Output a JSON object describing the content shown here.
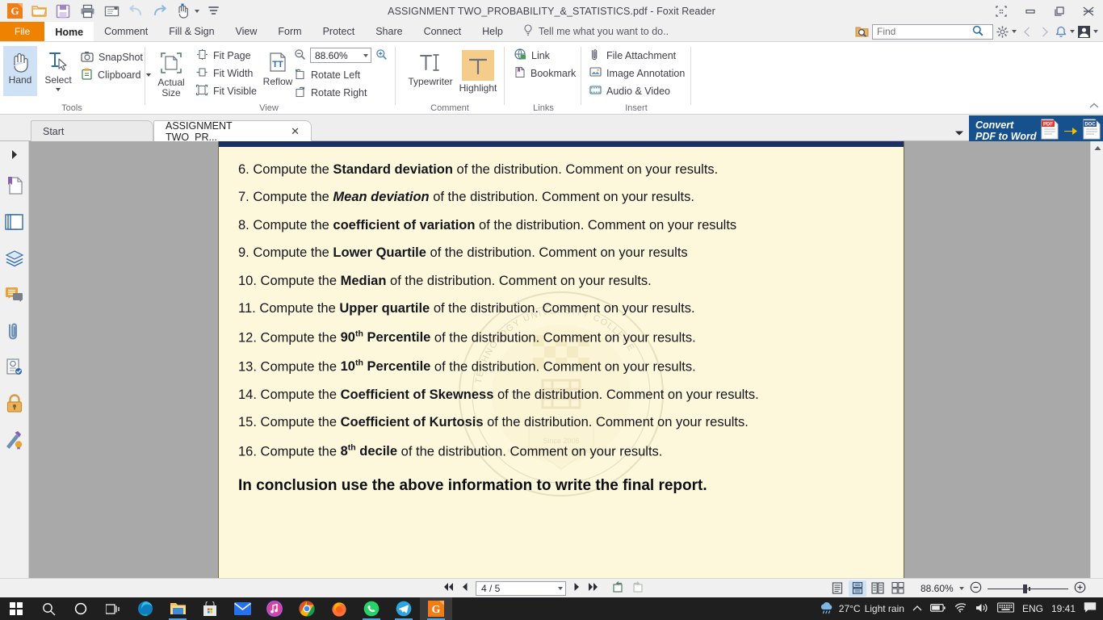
{
  "window": {
    "title": "ASSIGNMENT TWO_PROBABILITY_&_STATISTICS.pdf - Foxit Reader",
    "controls": [
      "restore-all-icon",
      "minimize-icon",
      "maximize-icon",
      "close-icon"
    ]
  },
  "quick_access": [
    {
      "name": "foxit-logo-icon",
      "label": "Foxit"
    },
    {
      "name": "open-folder-icon",
      "label": "Open"
    },
    {
      "name": "save-icon",
      "label": "Save"
    },
    {
      "name": "print-icon",
      "label": "Print"
    },
    {
      "name": "email-icon",
      "label": "Email"
    },
    {
      "name": "undo-icon",
      "label": "Undo"
    },
    {
      "name": "redo-icon",
      "label": "Redo"
    },
    {
      "name": "hand-tool-icon",
      "label": "Hand Tool"
    },
    {
      "name": "customize-toolbar-icon",
      "label": "Customize"
    }
  ],
  "menu": {
    "tabs": [
      {
        "label": "File",
        "kind": "file"
      },
      {
        "label": "Home",
        "kind": "active"
      },
      {
        "label": "Comment",
        "kind": "normal"
      },
      {
        "label": "Fill & Sign",
        "kind": "normal"
      },
      {
        "label": "View",
        "kind": "normal"
      },
      {
        "label": "Form",
        "kind": "normal"
      },
      {
        "label": "Protect",
        "kind": "normal"
      },
      {
        "label": "Share",
        "kind": "normal"
      },
      {
        "label": "Connect",
        "kind": "normal"
      },
      {
        "label": "Help",
        "kind": "normal"
      }
    ],
    "tell_me": "Tell me what you want to do..",
    "find_placeholder": "Find",
    "find_value": ""
  },
  "ribbon": {
    "groups": [
      {
        "label": "Tools",
        "big": [
          {
            "label": "Hand",
            "icon": "hand-icon",
            "selected": true
          },
          {
            "label": "Select",
            "icon": "select-text-icon",
            "selected": false,
            "dropdown": true
          }
        ],
        "small": [
          {
            "label": "SnapShot",
            "icon": "camera-icon",
            "dropdown": false
          },
          {
            "label": "Clipboard",
            "icon": "clipboard-icon",
            "dropdown": true
          }
        ]
      },
      {
        "label": "View",
        "big": [
          {
            "label": "Actual Size",
            "icon": "actual-size-icon",
            "selected": false
          },
          {
            "label": "Reflow",
            "icon": "reflow-icon",
            "selected": false
          }
        ],
        "small": [
          {
            "label": "Fit Page",
            "icon": "fit-page-icon"
          },
          {
            "label": "Fit Width",
            "icon": "fit-width-icon"
          },
          {
            "label": "Fit Visible",
            "icon": "fit-visible-icon"
          },
          {
            "label": "Rotate Left",
            "icon": "rotate-left-icon"
          },
          {
            "label": "Rotate Right",
            "icon": "rotate-right-icon"
          }
        ],
        "zoom_value": "88.60%"
      },
      {
        "label": "Comment",
        "big": [
          {
            "label": "Typewriter",
            "icon": "typewriter-icon",
            "selected": false
          },
          {
            "label": "Highlight",
            "icon": "highlight-icon",
            "selected": true
          }
        ],
        "small": []
      },
      {
        "label": "Links",
        "big": [],
        "small": [
          {
            "label": "Link",
            "icon": "link-icon"
          },
          {
            "label": "Bookmark",
            "icon": "bookmark-icon"
          }
        ]
      },
      {
        "label": "Insert",
        "big": [],
        "small": [
          {
            "label": "File Attachment",
            "icon": "attachment-icon"
          },
          {
            "label": "Image Annotation",
            "icon": "image-annotation-icon"
          },
          {
            "label": "Audio & Video",
            "icon": "audio-video-icon"
          }
        ]
      }
    ]
  },
  "doc_tabs": [
    {
      "label": "Start",
      "active": false,
      "closable": false
    },
    {
      "label": "ASSIGNMENT TWO_PR...",
      "active": true,
      "closable": true,
      "close_glyph": "✕"
    }
  ],
  "convert_banner": {
    "line1": "Convert",
    "line2": "PDF to Word",
    "from_badge": "PDF",
    "to_badge": "DOC"
  },
  "nav_rail": [
    {
      "name": "expand-panel-icon",
      "label": "Expand panel"
    },
    {
      "name": "bookmarks-panel-icon",
      "label": "Bookmarks"
    },
    {
      "name": "pages-panel-icon",
      "label": "Page Thumbnails"
    },
    {
      "name": "layers-panel-icon",
      "label": "Layers"
    },
    {
      "name": "comments-panel-icon",
      "label": "Comments"
    },
    {
      "name": "attachments-panel-icon",
      "label": "Attachments"
    },
    {
      "name": "stamps-panel-icon",
      "label": "Stamps"
    },
    {
      "name": "security-panel-icon",
      "label": "Security"
    },
    {
      "name": "signatures-panel-icon",
      "label": "Digital Signatures"
    }
  ],
  "document": {
    "watermark_text": "AKENTEN APPIAH-MENKA UNIVERSITY OF SKILLS TRAINING AND ENTREPRENEURIAL DEVELOPMENT",
    "questions": [
      {
        "num": "6.",
        "pre": "Compute the ",
        "em": "Standard deviation",
        "em_style": "bold",
        "sup": "",
        "post": " of the distribution. Comment on your results."
      },
      {
        "num": "7.",
        "pre": "Compute the ",
        "em": "Mean deviation",
        "em_style": "bold-italic",
        "sup": "",
        "post": " of the distribution. Comment on your results."
      },
      {
        "num": "8.",
        "pre": "Compute the ",
        "em": "coefficient of variation",
        "em_style": "bold",
        "sup": "",
        "post": " of the distribution. Comment on your results"
      },
      {
        "num": "9.",
        "pre": "Compute the ",
        "em": "Lower Quartile",
        "em_style": "bold",
        "sup": "",
        "post": " of the distribution. Comment on your results"
      },
      {
        "num": "10.",
        "pre": "Compute the ",
        "em": "Median",
        "em_style": "bold",
        "sup": "",
        "post": " of the distribution. Comment on your results."
      },
      {
        "num": "11.",
        "pre": "Compute the ",
        "em": "Upper quartile",
        "em_style": "bold",
        "sup": "",
        "post": " of the distribution. Comment on your results."
      },
      {
        "num": "12.",
        "pre": "Compute the ",
        "em": "90",
        "em_style": "bold",
        "sup": "th",
        "sup_post": " Percentile",
        "post": " of the distribution. Comment on your results."
      },
      {
        "num": "13.",
        "pre": "Compute the ",
        "em": "10",
        "em_style": "bold",
        "sup": "th",
        "sup_post": " Percentile",
        "post": " of the distribution. Comment on your results."
      },
      {
        "num": "14.",
        "pre": "Compute the ",
        "em": "Coefficient of Skewness",
        "em_style": "bold",
        "sup": "",
        "post": " of the distribution. Comment on your results."
      },
      {
        "num": "15.",
        "pre": "Compute the ",
        "em": "Coefficient of Kurtosis",
        "em_style": "bold",
        "sup": "",
        "post": " of the distribution. Comment on your results."
      },
      {
        "num": "16.",
        "pre": "Compute the ",
        "em": "8",
        "em_style": "bold",
        "sup": "th",
        "sup_post": " decile",
        "post": " of the distribution. Comment on your results."
      }
    ],
    "conclusion": "In conclusion use the above information to write the final report."
  },
  "statusbar": {
    "first_page_icon": "first-page-icon",
    "prev_page_icon": "previous-page-icon",
    "page_value": "4 / 5",
    "next_page_icon": "next-page-icon",
    "last_page_icon": "last-page-icon",
    "prev_view_icon": "previous-view-icon",
    "next_view_icon": "next-view-icon",
    "view_modes": [
      {
        "name": "single-page-mode-icon",
        "selected": false
      },
      {
        "name": "continuous-page-mode-icon",
        "selected": true
      },
      {
        "name": "facing-page-mode-icon",
        "selected": false
      },
      {
        "name": "continuous-facing-mode-icon",
        "selected": false
      }
    ],
    "zoom_value": "88.60%",
    "zoom_out_icon": "zoom-out-icon",
    "zoom_in_icon": "zoom-in-icon"
  },
  "taskbar": {
    "items": [
      {
        "name": "start-button-icon",
        "label": "Start",
        "active": false,
        "running": false
      },
      {
        "name": "search-icon",
        "label": "Search",
        "active": false,
        "running": false
      },
      {
        "name": "cortana-icon",
        "label": "Cortana",
        "active": false,
        "running": false
      },
      {
        "name": "task-view-icon",
        "label": "Task View",
        "active": false,
        "running": false
      },
      {
        "name": "edge-icon",
        "label": "Microsoft Edge",
        "active": false,
        "running": false
      },
      {
        "name": "file-explorer-icon",
        "label": "File Explorer",
        "active": false,
        "running": true
      },
      {
        "name": "microsoft-store-icon",
        "label": "Microsoft Store",
        "active": false,
        "running": false
      },
      {
        "name": "mail-icon",
        "label": "Mail",
        "active": false,
        "running": false
      },
      {
        "name": "itunes-icon",
        "label": "iTunes",
        "active": false,
        "running": false
      },
      {
        "name": "chrome-icon",
        "label": "Google Chrome",
        "active": false,
        "running": true
      },
      {
        "name": "firefox-icon",
        "label": "Mozilla Firefox",
        "active": false,
        "running": false
      },
      {
        "name": "whatsapp-icon",
        "label": "WhatsApp",
        "active": false,
        "running": true
      },
      {
        "name": "telegram-icon",
        "label": "Telegram",
        "active": false,
        "running": true
      },
      {
        "name": "foxit-reader-icon",
        "label": "Foxit Reader",
        "active": true,
        "running": true
      }
    ],
    "tray": {
      "weather_icon": "rain-cloud-icon",
      "temperature": "27°C",
      "condition": "Light rain",
      "show_hidden_icon": "chevron-up-icon",
      "battery_icon": "battery-icon",
      "network_icon": "wifi-icon",
      "volume_icon": "speaker-icon",
      "keyboard_icon": "keyboard-icon",
      "language": "ENG",
      "time": "19:41",
      "action_center_icon": "action-center-icon"
    }
  },
  "colors": {
    "accent_orange": "#ef8200",
    "convert_blue": "#17518d",
    "page_bg": "#fdf8dc",
    "doc_bg": "#a9a9a9",
    "selection_blue": "#cfe1f5",
    "highlight_orange": "#f5cd8b"
  }
}
